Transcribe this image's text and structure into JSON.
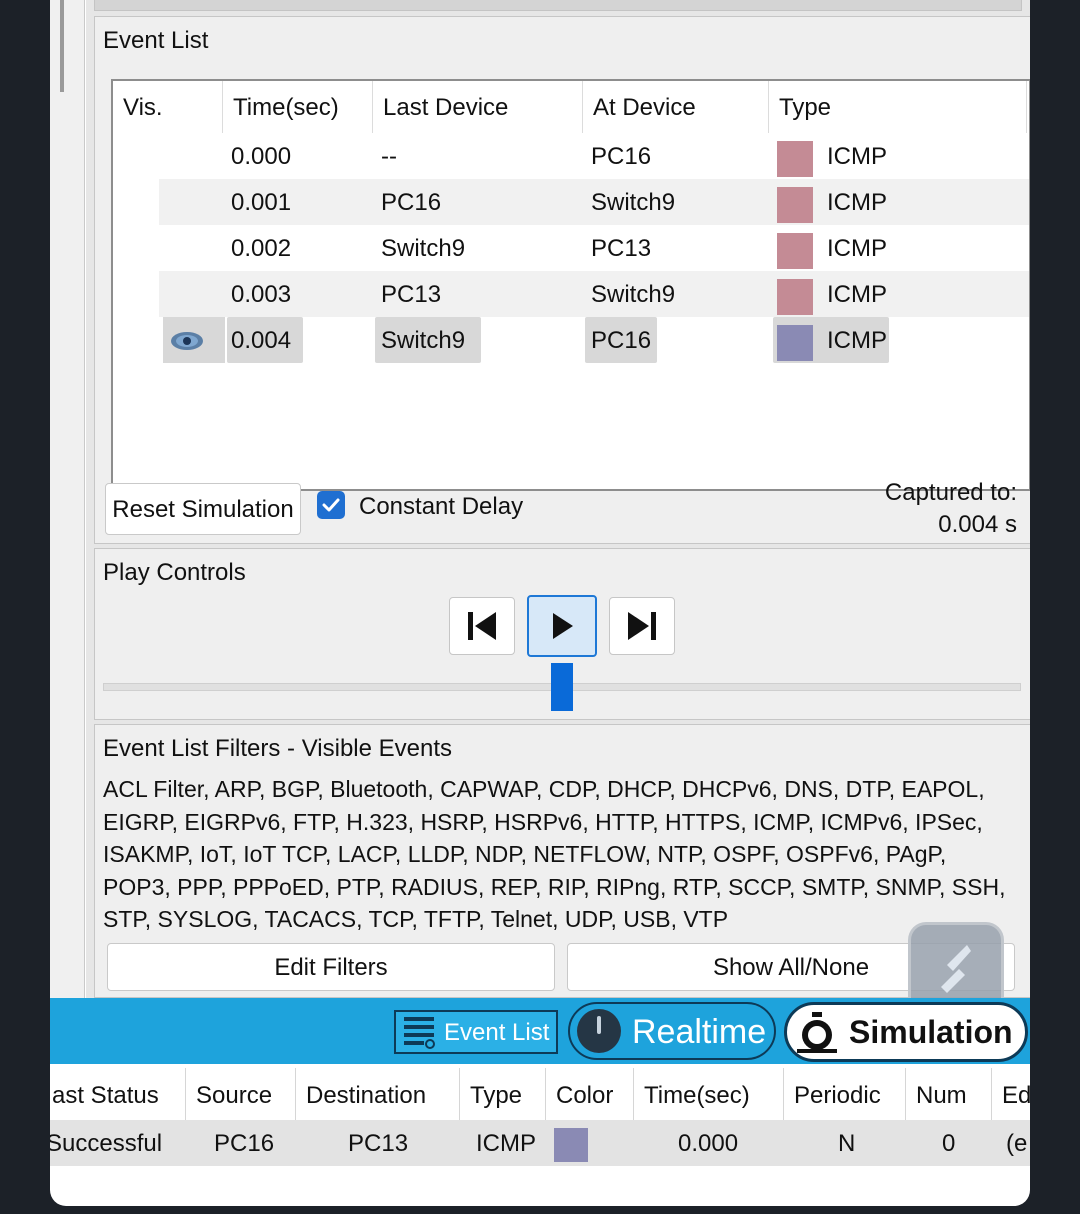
{
  "event_list": {
    "title": "Event List",
    "columns": [
      "Vis.",
      "Time(sec)",
      "Last Device",
      "At Device",
      "Type"
    ],
    "rows": [
      {
        "time": "0.000",
        "last_device": "--",
        "at_device": "PC16",
        "type": "ICMP",
        "color": "#c48b95",
        "visible_icon": false
      },
      {
        "time": "0.001",
        "last_device": "PC16",
        "at_device": "Switch9",
        "type": "ICMP",
        "color": "#c48b95",
        "visible_icon": false
      },
      {
        "time": "0.002",
        "last_device": "Switch9",
        "at_device": "PC13",
        "type": "ICMP",
        "color": "#c48b95",
        "visible_icon": false
      },
      {
        "time": "0.003",
        "last_device": "PC13",
        "at_device": "Switch9",
        "type": "ICMP",
        "color": "#c48b95",
        "visible_icon": false
      },
      {
        "time": "0.004",
        "last_device": "Switch9",
        "at_device": "PC16",
        "type": "ICMP",
        "color": "#8a8ab4",
        "visible_icon": true
      }
    ],
    "reset_button": "Reset Simulation",
    "constant_delay_label": "Constant Delay",
    "constant_delay_checked": true,
    "captured_label": "Captured to:",
    "captured_value": "0.004 s"
  },
  "play_controls": {
    "title": "Play Controls",
    "back_icon": "skip-back-icon",
    "play_icon": "play-icon",
    "forward_icon": "skip-forward-icon"
  },
  "filters": {
    "title": "Event List Filters - Visible Events",
    "lines": [
      "ACL Filter, ARP, BGP, Bluetooth, CAPWAP, CDP, DHCP, DHCPv6, DNS, DTP, EAPOL,",
      "EIGRP, EIGRPv6, FTP, H.323, HSRP, HSRPv6, HTTP, HTTPS, ICMP, ICMPv6, IPSec,",
      "ISAKMP, IoT, IoT TCP, LACP, LLDP, NDP, NETFLOW, NTP, OSPF, OSPFv6, PAgP,",
      "POP3, PPP, PPPoED, PTP, RADIUS, REP, RIP, RIPng, RTP, SCCP, SMTP, SNMP, SSH,",
      "STP, SYSLOG, TACACS, TCP, TFTP, Telnet, UDP, USB, VTP"
    ],
    "edit_button": "Edit Filters",
    "show_button": "Show All/None"
  },
  "mode_bar": {
    "event_list_label": "Event List",
    "realtime_label": "Realtime",
    "simulation_label": "Simulation",
    "accent": "#1ea3dc"
  },
  "pdu_table": {
    "columns": [
      "ast Status",
      "Source",
      "Destination",
      "Type",
      "Color",
      "Time(sec)",
      "Periodic",
      "Num",
      "Ed"
    ],
    "row": {
      "status": "Successful",
      "source": "PC16",
      "destination": "PC13",
      "type": "ICMP",
      "color": "#8a8ab4",
      "time": "0.000",
      "periodic": "N",
      "num": "0",
      "edit": "(e"
    }
  }
}
